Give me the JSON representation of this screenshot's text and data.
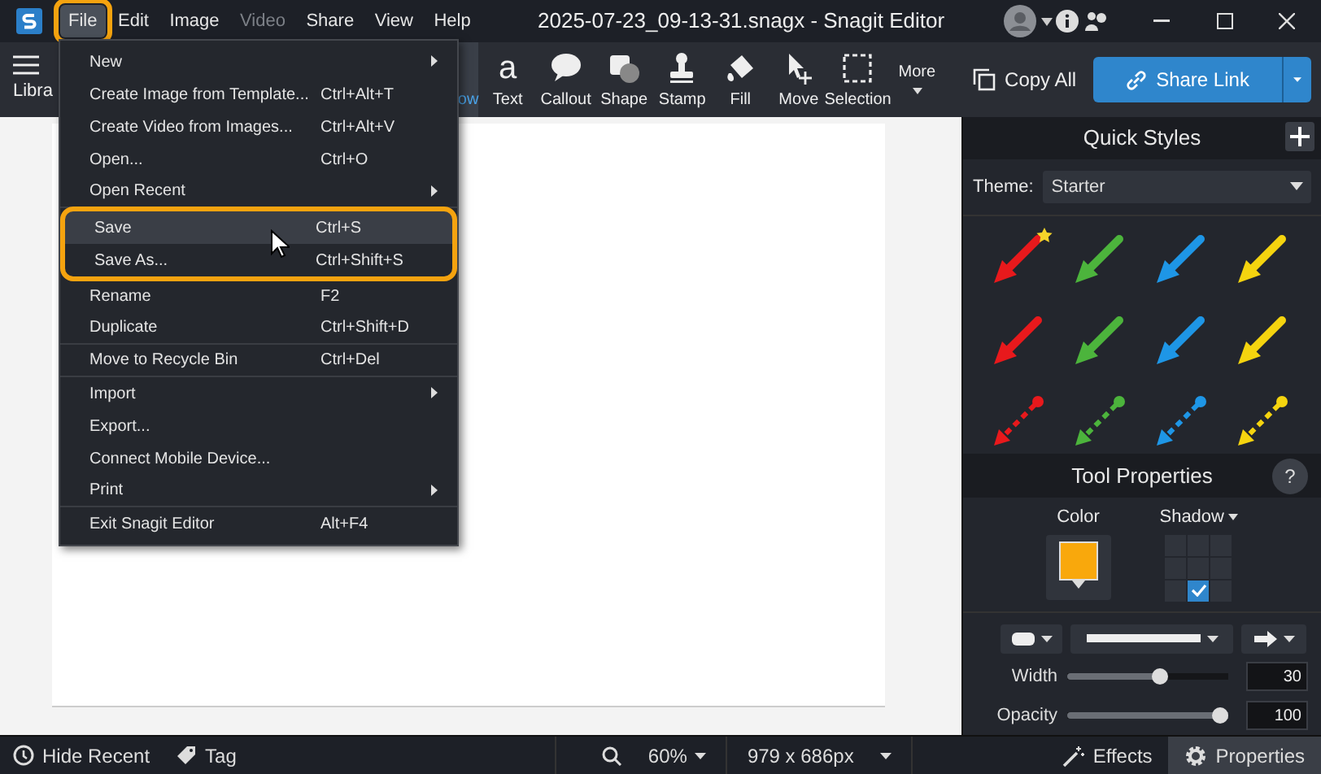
{
  "window": {
    "title": "2025-07-23_09-13-31.snagx - Snagit Editor"
  },
  "menu_bar": [
    {
      "label": "File",
      "open": true,
      "annotated": true,
      "disabled": false
    },
    {
      "label": "Edit",
      "open": false,
      "annotated": false,
      "disabled": false
    },
    {
      "label": "Image",
      "open": false,
      "annotated": false,
      "disabled": false
    },
    {
      "label": "Video",
      "open": false,
      "annotated": false,
      "disabled": true
    },
    {
      "label": "Share",
      "open": false,
      "annotated": false,
      "disabled": false
    },
    {
      "label": "View",
      "open": false,
      "annotated": false,
      "disabled": false
    },
    {
      "label": "Help",
      "open": false,
      "annotated": false,
      "disabled": false
    }
  ],
  "library": {
    "label": "Libra"
  },
  "tools": [
    {
      "kind": "arrow",
      "label": "ow",
      "selected": true
    },
    {
      "kind": "text",
      "label": "Text",
      "glyph": "a",
      "selected": false
    },
    {
      "kind": "callout",
      "label": "Callout",
      "selected": false
    },
    {
      "kind": "shape",
      "label": "Shape",
      "selected": false
    },
    {
      "kind": "stamp",
      "label": "Stamp",
      "selected": false
    },
    {
      "kind": "fill",
      "label": "Fill",
      "selected": false
    },
    {
      "kind": "move",
      "label": "Move",
      "selected": false
    },
    {
      "kind": "selection",
      "label": "Selection",
      "selected": false
    },
    {
      "kind": "more",
      "label": "More",
      "selected": false
    }
  ],
  "copy_all": "Copy All",
  "share_link": "Share Link",
  "file_menu": [
    {
      "label": "New",
      "submenu": true,
      "selected": false,
      "annotated": false,
      "separator_after": false
    },
    {
      "label": "Create Image from Template...",
      "shortcut": "Ctrl+Alt+T",
      "submenu": false,
      "selected": false,
      "annotated": false,
      "separator_after": false
    },
    {
      "label": "Create Video from Images...",
      "shortcut": "Ctrl+Alt+V",
      "submenu": false,
      "selected": false,
      "annotated": false,
      "separator_after": false
    },
    {
      "label": "Open...",
      "shortcut": "Ctrl+O",
      "submenu": false,
      "selected": false,
      "annotated": false,
      "separator_after": false
    },
    {
      "label": "Open Recent",
      "submenu": true,
      "selected": false,
      "annotated": false,
      "separator_after": true
    },
    {
      "label": "Save",
      "shortcut": "Ctrl+S",
      "submenu": false,
      "selected": true,
      "annotated": true,
      "separator_after": false
    },
    {
      "label": "Save As...",
      "shortcut": "Ctrl+Shift+S",
      "submenu": false,
      "selected": false,
      "annotated": true,
      "separator_after": false
    },
    {
      "label": "Rename",
      "shortcut": "F2",
      "submenu": false,
      "selected": false,
      "annotated": false,
      "separator_after": false
    },
    {
      "label": "Duplicate",
      "shortcut": "Ctrl+Shift+D",
      "submenu": false,
      "selected": false,
      "annotated": false,
      "separator_after": true
    },
    {
      "label": "Move to Recycle Bin",
      "shortcut": "Ctrl+Del",
      "submenu": false,
      "selected": false,
      "annotated": false,
      "separator_after": true
    },
    {
      "label": "Import",
      "submenu": true,
      "selected": false,
      "annotated": false,
      "separator_after": false
    },
    {
      "label": "Export...",
      "submenu": false,
      "selected": false,
      "annotated": false,
      "separator_after": false
    },
    {
      "label": "Connect Mobile Device...",
      "submenu": false,
      "selected": false,
      "annotated": false,
      "separator_after": false
    },
    {
      "label": "Print",
      "submenu": true,
      "selected": false,
      "annotated": false,
      "separator_after": true
    },
    {
      "label": "Exit Snagit Editor",
      "shortcut": "Alt+F4",
      "submenu": false,
      "selected": false,
      "annotated": false,
      "separator_after": false
    }
  ],
  "quick_styles": {
    "title": "Quick Styles",
    "theme_label": "Theme:",
    "theme": "Starter",
    "styles": [
      {
        "kind": "solid",
        "color": "#e8191c",
        "favorite": true
      },
      {
        "kind": "solid",
        "color": "#4cb43c",
        "favorite": false
      },
      {
        "kind": "solid",
        "color": "#1e96e6",
        "favorite": false
      },
      {
        "kind": "solid",
        "color": "#f5d40f",
        "favorite": false
      },
      {
        "kind": "solid",
        "color": "#e8191c",
        "favorite": false
      },
      {
        "kind": "solid",
        "color": "#4cb43c",
        "favorite": false
      },
      {
        "kind": "solid",
        "color": "#1e96e6",
        "favorite": false
      },
      {
        "kind": "solid",
        "color": "#f5d40f",
        "favorite": false
      },
      {
        "kind": "dashed",
        "color": "#e8191c",
        "favorite": false
      },
      {
        "kind": "dashed",
        "color": "#4cb43c",
        "favorite": false
      },
      {
        "kind": "dashed",
        "color": "#1e96e6",
        "favorite": false
      },
      {
        "kind": "dashed",
        "color": "#f5d40f",
        "favorite": false
      }
    ]
  },
  "tool_properties": {
    "title": "Tool Properties",
    "help": "?",
    "color_label": "Color",
    "color": "#f9a80c",
    "shadow_label": "Shadow",
    "shadow_cells": [
      {
        "selected": false
      },
      {
        "selected": false
      },
      {
        "selected": false
      },
      {
        "selected": false
      },
      {
        "selected": false
      },
      {
        "selected": false
      },
      {
        "selected": false
      },
      {
        "selected": true
      },
      {
        "selected": false
      }
    ],
    "sliders": [
      {
        "label": "Width",
        "level": 0.58,
        "value": "30"
      },
      {
        "label": "Opacity",
        "level": 1.0,
        "value": "100"
      }
    ]
  },
  "status_bar": {
    "hide_recent": "Hide Recent",
    "tag": "Tag",
    "zoom": "60%",
    "size": "979 x 686px",
    "panels": [
      {
        "kind": "effects",
        "label": "Effects",
        "selected": false
      },
      {
        "kind": "properties",
        "label": "Properties",
        "selected": true
      }
    ]
  }
}
